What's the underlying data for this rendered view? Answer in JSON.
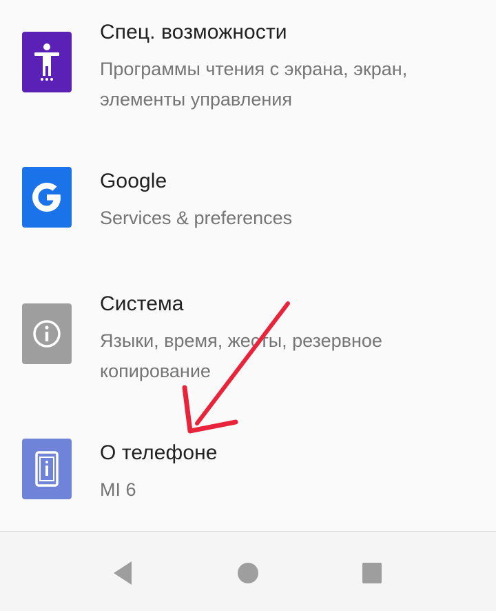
{
  "settings": {
    "items": [
      {
        "title": "Спец. возможности",
        "subtitle": "Программы чтения с экрана, экран, элементы управления",
        "icon": "accessibility-icon",
        "icon_color": "#5b21b6"
      },
      {
        "title": "Google",
        "subtitle": "Services & preferences",
        "icon": "google-icon",
        "icon_color": "#1a73e8"
      },
      {
        "title": "Система",
        "subtitle": "Языки, время, жесты, резервное копирование",
        "icon": "info-icon",
        "icon_color": "#9e9e9e"
      },
      {
        "title": "О телефоне",
        "subtitle": "MI 6",
        "icon": "phone-info-icon",
        "icon_color": "#6f84d8"
      }
    ]
  },
  "navbar": {
    "back_icon": "back-triangle-icon",
    "home_icon": "home-circle-icon",
    "recents_icon": "recents-square-icon"
  },
  "annotation": {
    "arrow_color": "#e8243a"
  }
}
